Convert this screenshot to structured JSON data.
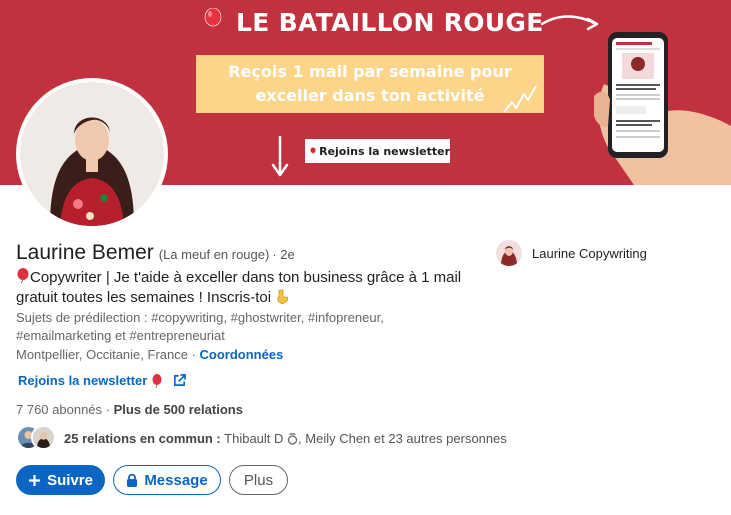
{
  "banner": {
    "title": "LE BATAILLON ROUGE",
    "promo_line1": "Reçois 1 mail par semaine pour",
    "promo_line2": "exceller dans ton activité",
    "cta": "Rejoins la newsletter"
  },
  "profile": {
    "name": "Laurine Bemer",
    "pronoun": "(La meuf en rouge)",
    "degree": "· 2e",
    "headline": "Copywriter | Je t'aide à exceller dans ton business grâce à 1 mail gratuit toutes les semaines ! Inscris-toi",
    "topics": "Sujets de prédilection : #copywriting, #ghostwriter, #infopreneur, #emailmarketing et #entrepreneuriat",
    "location": "Montpellier, Occitanie, France",
    "location_sep": " · ",
    "contact_link": "Coordonnées",
    "newsletter_link": "Rejoins la newsletter",
    "followers": "7 760 abonnés",
    "relations_sep": " · ",
    "relations": "Plus de 500 relations",
    "mutual_count": "25 relations en commun :",
    "mutual_names_1": "Thibault D",
    "mutual_names_2": ", Meily Chen et 23 autres personnes"
  },
  "company": {
    "name": "Laurine Copywriting"
  },
  "actions": {
    "follow": "Suivre",
    "message": "Message",
    "more": "Plus"
  },
  "colors": {
    "banner": "#c1313e",
    "promo": "#fcd58b",
    "accent": "#0a66c2"
  },
  "icons": [
    "balloon-icon",
    "external-link-icon",
    "pointing-down-icon",
    "lock-icon",
    "plus-icon",
    "ring-icon"
  ]
}
